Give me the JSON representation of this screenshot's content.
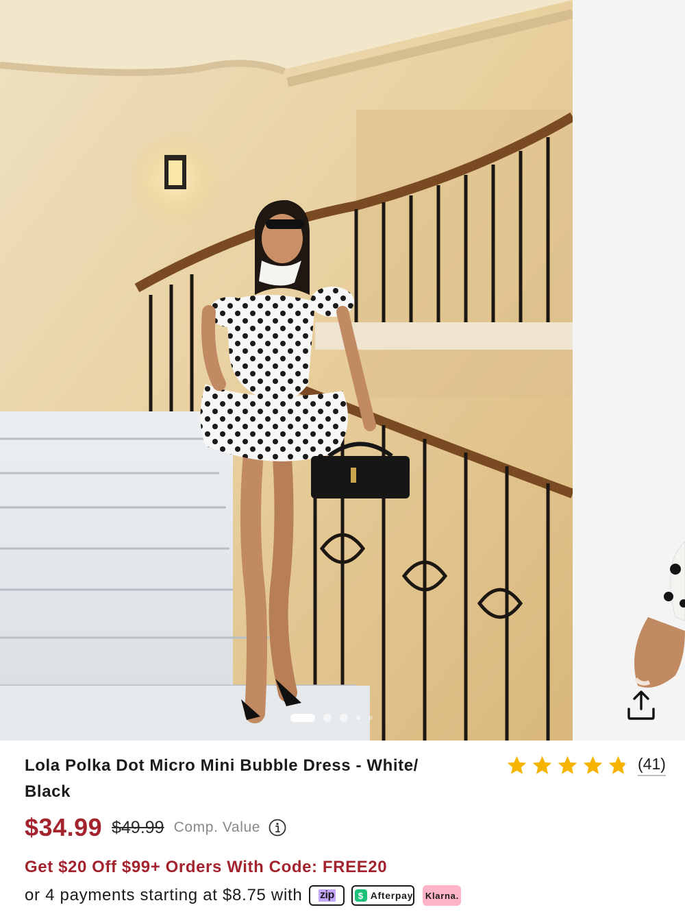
{
  "product": {
    "title": "Lola Polka Dot Micro Mini Bubble Dress - White/ Black",
    "rating_stars": 4.9,
    "review_count": "(41)",
    "price": "$34.99",
    "original_price": "$49.99",
    "comp_value_label": "Comp. Value"
  },
  "carousel": {
    "slide_count": 5,
    "active_index": 0,
    "share_icon": "share-icon"
  },
  "promo": {
    "text": "Get $20 Off $99+ Orders With Code: FREE20"
  },
  "payments": {
    "text": "or 4 payments starting at $8.75 with",
    "providers": [
      "zip",
      "Afterpay",
      "Klarna."
    ]
  },
  "colors": {
    "price_red": "#a3242e",
    "star_gold": "#f5b400",
    "muted_gray": "#888888"
  }
}
